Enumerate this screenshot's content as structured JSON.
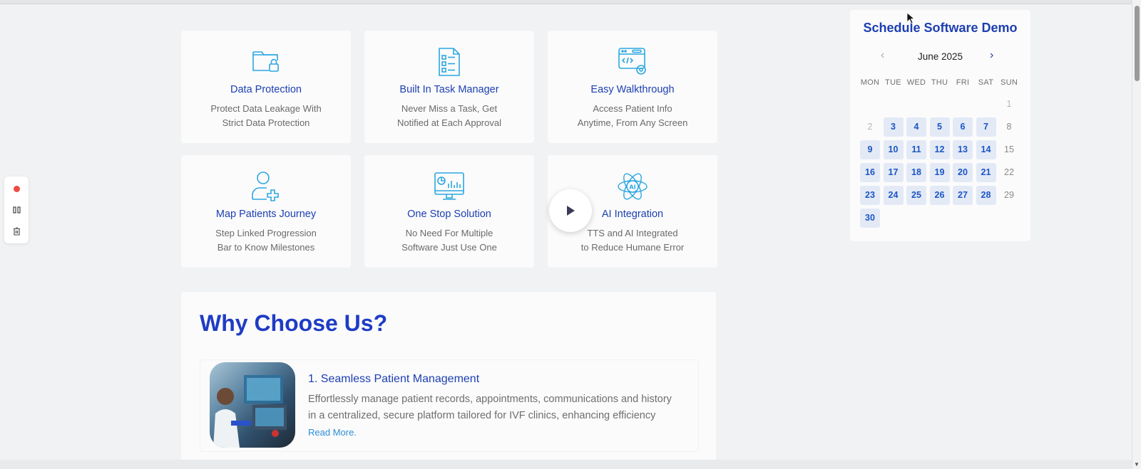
{
  "features": [
    {
      "icon": "folder-lock-icon",
      "title": "Data Protection",
      "desc_line1": "Protect Data Leakage With",
      "desc_line2": "Strict Data Protection"
    },
    {
      "icon": "checklist-icon",
      "title": "Built In Task Manager",
      "desc_line1": "Never Miss a Task, Get",
      "desc_line2": "Notified at Each Approval"
    },
    {
      "icon": "code-window-gear-icon",
      "title": "Easy Walkthrough",
      "desc_line1": "Access Patient Info",
      "desc_line2": "Anytime, From Any Screen"
    },
    {
      "icon": "user-add-icon",
      "title": "Map Patients Journey",
      "desc_line1": "Step Linked Progression",
      "desc_line2": "Bar to Know Milestones"
    },
    {
      "icon": "analytics-monitor-icon",
      "title": "One Stop Solution",
      "desc_line1": "No Need For Multiple",
      "desc_line2": "Software Just Use One"
    },
    {
      "icon": "ai-atom-icon",
      "title": "AI Integration",
      "desc_line1": "TTS and AI Integrated",
      "desc_line2": "to Reduce Humane Error"
    }
  ],
  "why": {
    "title": "Why Choose Us?",
    "items": [
      {
        "title": "1. Seamless Patient Management",
        "text": "Effortlessly manage patient records, appointments, communications and history in a centralized, secure platform tailored for IVF clinics, enhancing efficiency",
        "link": "Read More."
      }
    ]
  },
  "calendar": {
    "title": "Schedule Software Demo",
    "month": "June 2025",
    "weekdays": [
      "MON",
      "TUE",
      "WED",
      "THU",
      "FRI",
      "SAT",
      "SUN"
    ],
    "leading_blanks": 6,
    "days": [
      {
        "d": "1",
        "s": "muted"
      },
      {
        "d": "2",
        "s": "muted"
      },
      {
        "d": "3",
        "s": "avail"
      },
      {
        "d": "4",
        "s": "avail"
      },
      {
        "d": "5",
        "s": "avail"
      },
      {
        "d": "6",
        "s": "avail"
      },
      {
        "d": "7",
        "s": "avail"
      },
      {
        "d": "8",
        "s": "na"
      },
      {
        "d": "9",
        "s": "avail"
      },
      {
        "d": "10",
        "s": "avail"
      },
      {
        "d": "11",
        "s": "avail"
      },
      {
        "d": "12",
        "s": "avail"
      },
      {
        "d": "13",
        "s": "avail"
      },
      {
        "d": "14",
        "s": "avail"
      },
      {
        "d": "15",
        "s": "na"
      },
      {
        "d": "16",
        "s": "avail"
      },
      {
        "d": "17",
        "s": "avail"
      },
      {
        "d": "18",
        "s": "avail"
      },
      {
        "d": "19",
        "s": "avail"
      },
      {
        "d": "20",
        "s": "avail"
      },
      {
        "d": "21",
        "s": "avail"
      },
      {
        "d": "22",
        "s": "na"
      },
      {
        "d": "23",
        "s": "avail"
      },
      {
        "d": "24",
        "s": "avail"
      },
      {
        "d": "25",
        "s": "avail"
      },
      {
        "d": "26",
        "s": "avail"
      },
      {
        "d": "27",
        "s": "avail"
      },
      {
        "d": "28",
        "s": "avail"
      },
      {
        "d": "29",
        "s": "na"
      },
      {
        "d": "30",
        "s": "avail"
      }
    ]
  },
  "colors": {
    "accent": "#1c3fb0",
    "icon": "#2aa7e0",
    "available_day_bg": "#e3eaf6"
  }
}
